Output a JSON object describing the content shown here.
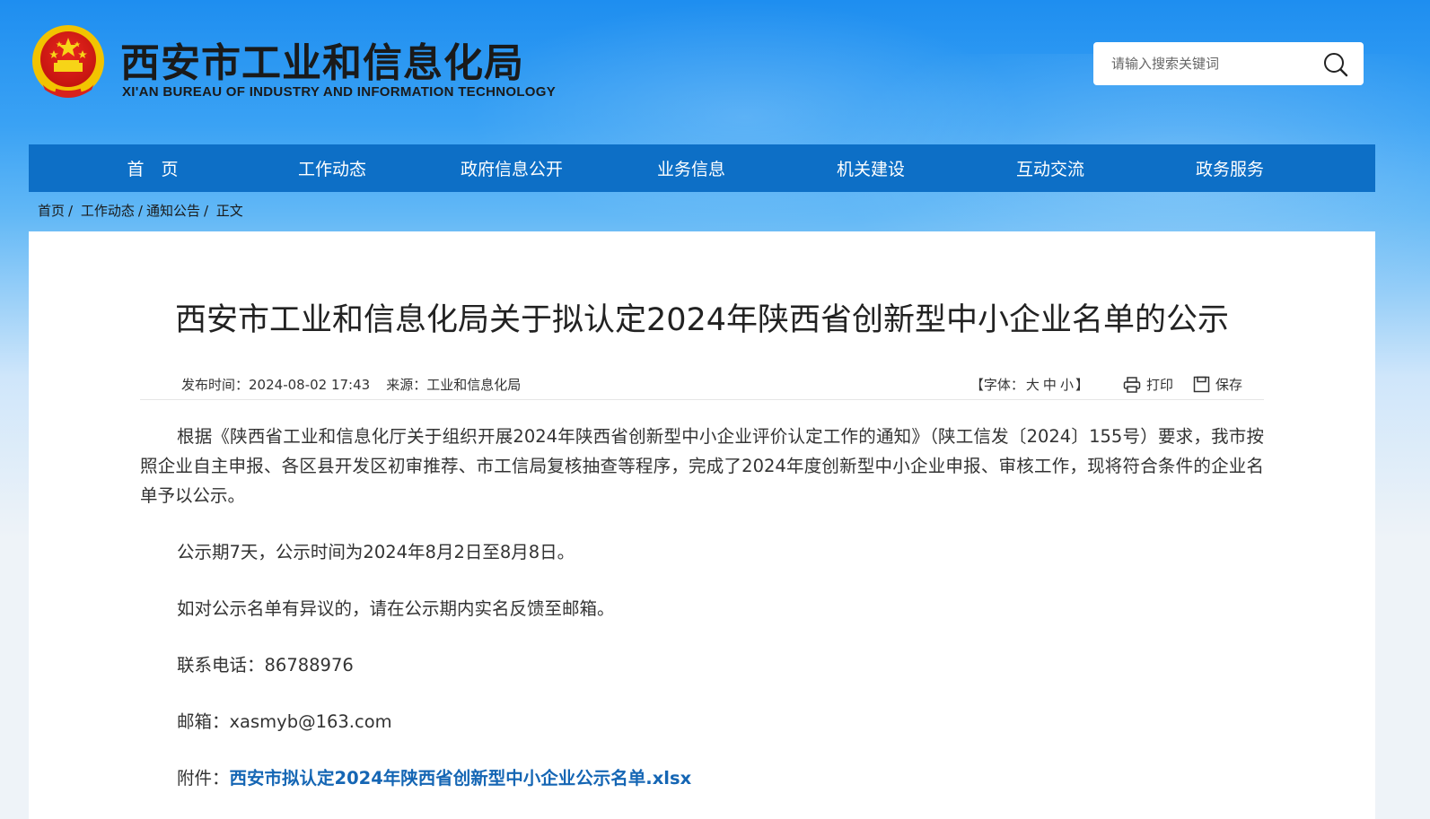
{
  "header": {
    "title": "西安市工业和信息化局",
    "subtitle": "XI'AN BUREAU OF INDUSTRY AND INFORMATION TECHNOLOGY",
    "search_placeholder": "请输入搜索关键词"
  },
  "nav": {
    "items": [
      "首　页",
      "工作动态",
      "政府信息公开",
      "业务信息",
      "机关建设",
      "互动交流",
      "政务服务"
    ]
  },
  "breadcrumb": {
    "items": [
      "首页",
      "工作动态",
      "通知公告",
      "正文"
    ]
  },
  "article": {
    "title": "西安市工业和信息化局关于拟认定2024年陕西省创新型中小企业名单的公示",
    "publish_label": "发布时间：",
    "publish_time": "2024-08-02 17:43",
    "source_label": "来源：",
    "source": "工业和信息化局",
    "font_label_open": "【字体：",
    "font_large": "大",
    "font_medium": "中",
    "font_small": "小",
    "font_label_close": "】",
    "print_label": "打印",
    "save_label": "保存",
    "para1": "根据《陕西省工业和信息化厅关于组织开展2024年陕西省创新型中小企业评价认定工作的通知》（陕工信发〔2024〕155号）要求，我市按照企业自主申报、各区县开发区初审推荐、市工信局复核抽查等程序，完成了2024年度创新型中小企业申报、审核工作，现将符合条件的企业名单予以公示。",
    "para2": "公示期7天，公示时间为2024年8月2日至8月8日。",
    "para3": "如对公示名单有异议的，请在公示期内实名反馈至邮箱。",
    "phone_label": "联系电话：",
    "phone": "86788976",
    "email_label": "邮箱：",
    "email": "xasmyb@163.com",
    "attachment_label": "附件：",
    "attachment_name": "西安市拟认定2024年陕西省创新型中小企业公示名单.xlsx"
  },
  "colors": {
    "nav_bg": "#0d6fc6",
    "link": "#1566b4",
    "header_top": "#1e8ef0"
  }
}
